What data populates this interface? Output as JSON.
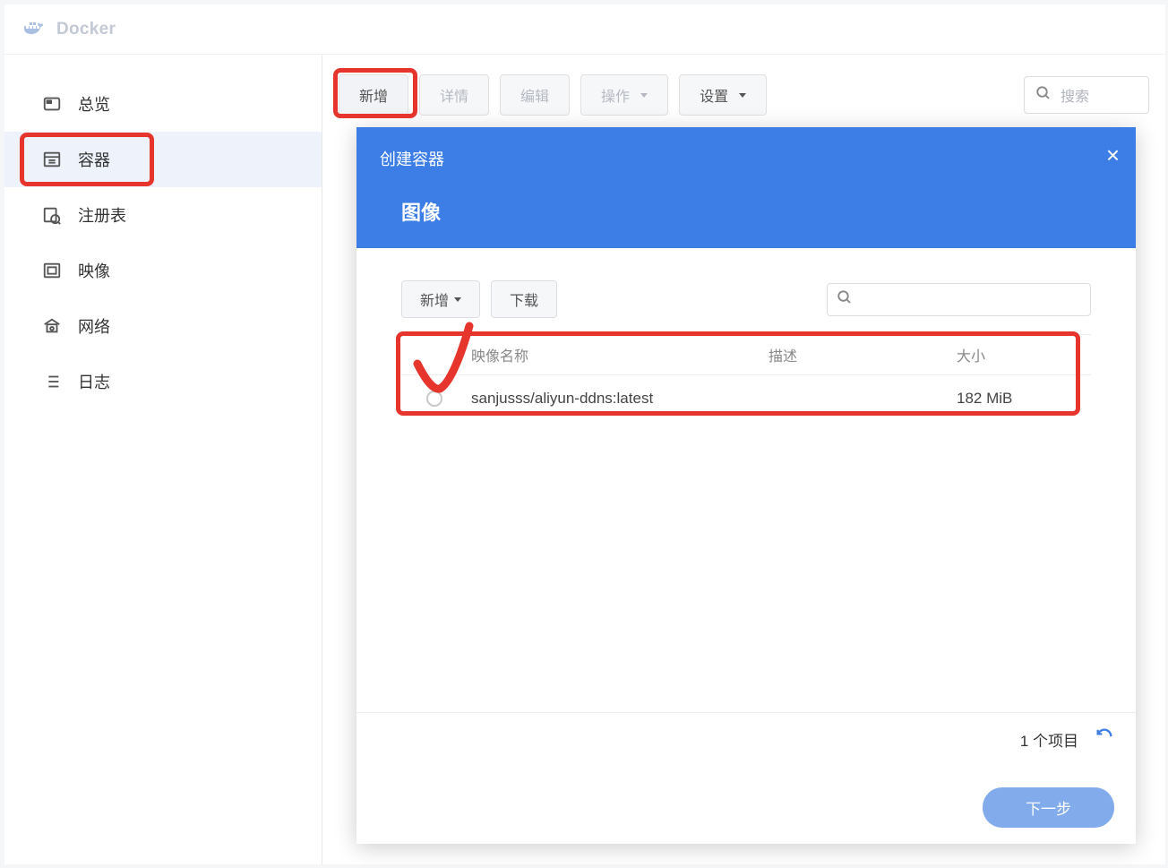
{
  "window": {
    "title": "Docker"
  },
  "sidebar": {
    "items": [
      {
        "label": "总览"
      },
      {
        "label": "容器"
      },
      {
        "label": "注册表"
      },
      {
        "label": "映像"
      },
      {
        "label": "网络"
      },
      {
        "label": "日志"
      }
    ]
  },
  "toolbar": {
    "add": "新增",
    "details": "详情",
    "edit": "编辑",
    "operation": "操作",
    "settings": "设置",
    "search_placeholder": "搜索"
  },
  "modal": {
    "title": "创建容器",
    "subtitle": "图像",
    "toolbar": {
      "add": "新增",
      "download": "下载"
    },
    "columns": {
      "name": "映像名称",
      "desc": "描述",
      "size": "大小"
    },
    "rows": [
      {
        "name": "sanjusss/aliyun-ddns:latest",
        "desc": "",
        "size": "182 MiB"
      }
    ],
    "footer": {
      "count": "1 个项目",
      "next": "下一步"
    }
  }
}
